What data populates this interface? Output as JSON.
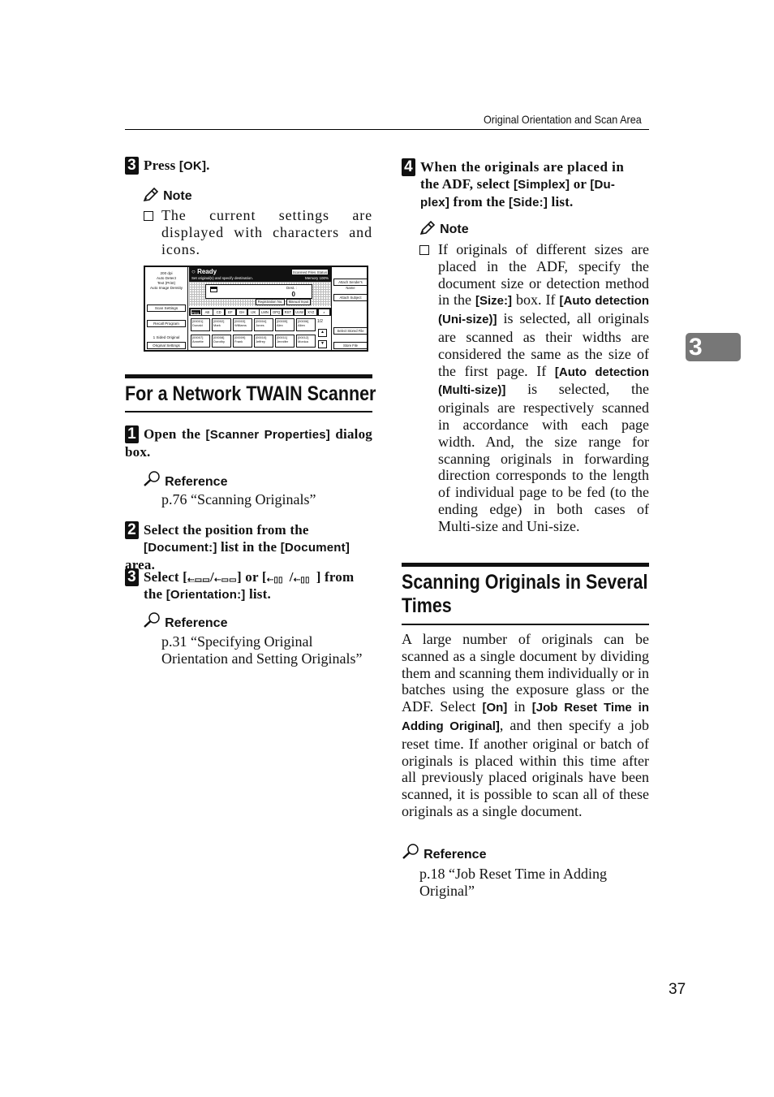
{
  "running_header": "Original Orientation and Scan Area",
  "chapter_tab": "3",
  "page_number": "37",
  "left_column": {
    "step3_top": {
      "number": "3",
      "parts": [
        {
          "t": "Press ",
          "k": false
        },
        {
          "t": "[OK]",
          "k": true
        },
        {
          "t": ".",
          "k": false
        }
      ],
      "note_label": "Note",
      "note_text": "The current settings are displayed with characters and icons."
    },
    "screen": {
      "left_info": [
        "200 dpi",
        "Auto Detect",
        "Text (Print)",
        "Auto Image Density"
      ],
      "scan_settings": "Scan Settings",
      "recall_program": "Recall Program",
      "sided": "1 Sided Original",
      "original_settings": "Original Settings",
      "ready": "Ready",
      "message": "Set original(s) and specify destination.",
      "scanned_files_status": "Scanned Files Status",
      "memory": "Memory 100%",
      "dest_label": "Dest. :",
      "dest_count": "0",
      "registration_no": "Registration No.",
      "manual_input": "Manual Input",
      "tabs": [
        "Freq.",
        "AB",
        "CD",
        "EF",
        "GH",
        "IJK",
        "LMN",
        "OPQ",
        "RST",
        "UVW",
        "XYZ"
      ],
      "names_row1": [
        {
          "id": "[00001]",
          "name": "Donald"
        },
        {
          "id": "[00002]",
          "name": "Mark"
        },
        {
          "id": "[00003]",
          "name": "Williams"
        },
        {
          "id": "[00004]",
          "name": "Jones"
        },
        {
          "id": "[00005]",
          "name": "Alex"
        },
        {
          "id": "[00006]",
          "name": "Allen"
        }
      ],
      "names_row2": [
        {
          "id": "[00007]",
          "name": "Annette"
        },
        {
          "id": "[00008]",
          "name": "Dorothy"
        },
        {
          "id": "[00009]",
          "name": "Frank"
        },
        {
          "id": "[00010]",
          "name": "Jeffrey"
        },
        {
          "id": "[00011]",
          "name": "Jennifer"
        },
        {
          "id": "[00012]",
          "name": "Monica"
        }
      ],
      "page_indicator": "1/2",
      "up_arrow": "▲",
      "down_arrow": "▼",
      "attach_sender": "Attach Sender's Name",
      "attach_subject": "Attach Subject",
      "select_stored_file": "Select Stored File",
      "store_file": "Store File"
    },
    "section_title": "For a Network TWAIN Scanner",
    "step1": {
      "number": "1",
      "parts": [
        {
          "t": "Open the ",
          "k": false
        },
        {
          "t": "[Scanner Properties]",
          "k": true
        },
        {
          "t": " dialog box.",
          "k": false
        }
      ],
      "ref_label": "Reference",
      "ref_text": "p.76 “Scanning Originals”"
    },
    "step2": {
      "number": "2",
      "parts": [
        {
          "t": "Select the position from the ",
          "k": false
        },
        {
          "t": "[Document:]",
          "k": true
        },
        {
          "t": " list in the ",
          "k": false
        },
        {
          "t": "[Document]",
          "k": true
        },
        {
          "t": " area.",
          "k": false
        }
      ]
    },
    "step3": {
      "number": "3",
      "select_word": "Select ",
      "or_word": " or ",
      "from_word": " from",
      "line2_pre": "the ",
      "orientation_kw": "[Orientation:]",
      "line2_post": " list.",
      "ref_label": "Reference",
      "ref_text": "p.31 “Specifying Original Orientation and Setting Originals”"
    }
  },
  "right_column": {
    "step4": {
      "number": "4",
      "line1": "When the originals are placed in",
      "line2_pre": "the ADF, select ",
      "simplex_kw": "[Simplex]",
      "or_word": " or ",
      "duplex_kw_a": "[Du-",
      "duplex_kw_b": "plex]",
      "line3_mid": " from the ",
      "side_kw": "[Side:]",
      "line3_post": " list.",
      "note_label": "Note",
      "note_parts": [
        {
          "t": "If originals of different sizes are placed in the ADF, specify the document size or detection method in the ",
          "k": false
        },
        {
          "t": "[Size:]",
          "k": true
        },
        {
          "t": " box. If ",
          "k": false
        },
        {
          "t": "[Auto detection (Uni-size)]",
          "k": true
        },
        {
          "t": " is selected, all originals are scanned as their widths are considered the same as the size of the first page. If ",
          "k": false
        },
        {
          "t": "[Auto detection (Multi-size)]",
          "k": true
        },
        {
          "t": " is selected, the originals are respectively scanned in accordance with each page width. And, the size range for scanning originals in forwarding direction corresponds to the length of individual page to be fed (to the ending edge) in both cases of Multi-size and Uni-size.",
          "k": false
        }
      ]
    },
    "section_title": "Scanning Originals in Several Times",
    "body_parts": [
      {
        "t": "A large number of originals can be scanned as a single document by dividing them and scanning them individually or in batches using the exposure glass or the ADF. Select ",
        "k": false
      },
      {
        "t": "[On]",
        "k": true
      },
      {
        "t": " in ",
        "k": false
      },
      {
        "t": "[Job Reset Time in Adding Original]",
        "k": true
      },
      {
        "t": ", and then specify a job reset time. If another original or batch of originals is placed within this time after all previously placed originals have been scanned, it is possible to scan all of these originals as a single document.",
        "k": false
      }
    ],
    "ref_label": "Reference",
    "ref_text": "p.18 “Job Reset Time in Adding Original”"
  }
}
